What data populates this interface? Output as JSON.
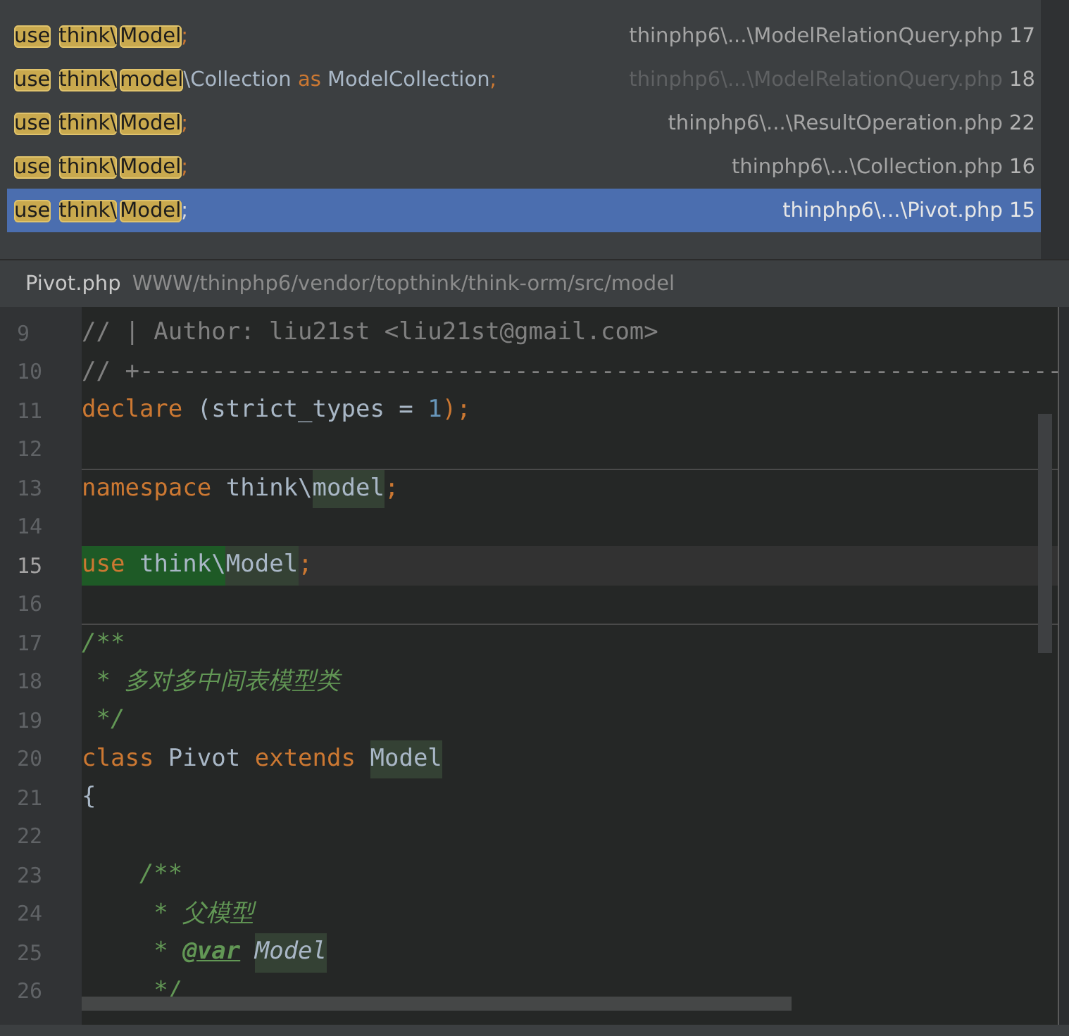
{
  "usages": [
    {
      "segments": [
        {
          "text": "use",
          "kind": "match"
        },
        {
          "text": "think\\",
          "kind": "match"
        },
        {
          "text": "Model",
          "kind": "match"
        },
        {
          "text": ";",
          "kind": "punct"
        }
      ],
      "file": "thinphp6\\...\\ModelRelationQuery.php",
      "line": "17",
      "dimmed": false,
      "selected": false
    },
    {
      "segments": [
        {
          "text": "use",
          "kind": "match"
        },
        {
          "text": "think\\",
          "kind": "match"
        },
        {
          "text": "model",
          "kind": "match"
        },
        {
          "text": "\\Collection ",
          "kind": "plain"
        },
        {
          "text": "as",
          "kind": "keyword"
        },
        {
          "text": " ModelCollection",
          "kind": "plain"
        },
        {
          "text": ";",
          "kind": "punct"
        }
      ],
      "file": "thinphp6\\...\\ModelRelationQuery.php",
      "line": "18",
      "dimmed": true,
      "selected": false
    },
    {
      "segments": [
        {
          "text": "use",
          "kind": "match"
        },
        {
          "text": "think\\",
          "kind": "match"
        },
        {
          "text": "Model",
          "kind": "match"
        },
        {
          "text": ";",
          "kind": "punct"
        }
      ],
      "file": "thinphp6\\...\\ResultOperation.php",
      "line": "22",
      "dimmed": false,
      "selected": false
    },
    {
      "segments": [
        {
          "text": "use",
          "kind": "match"
        },
        {
          "text": "think\\",
          "kind": "match"
        },
        {
          "text": "Model",
          "kind": "match"
        },
        {
          "text": ";",
          "kind": "punct"
        }
      ],
      "file": "thinphp6\\...\\Collection.php",
      "line": "16",
      "dimmed": false,
      "selected": false
    },
    {
      "segments": [
        {
          "text": "use",
          "kind": "match"
        },
        {
          "text": "think\\",
          "kind": "match"
        },
        {
          "text": "Model",
          "kind": "match"
        },
        {
          "text": ";",
          "kind": "punct"
        }
      ],
      "file": "thinphp6\\...\\Pivot.php",
      "line": "15",
      "dimmed": false,
      "selected": true
    }
  ],
  "preview": {
    "file_name": "Pivot.php",
    "path": "WWW/thinphp6/vendor/topthink/think-orm/src/model"
  },
  "code": [
    {
      "number": "9",
      "current": false,
      "separator_above": false,
      "tokens": [
        {
          "text": "// | Author: liu21st <liu21st@gmail.com>",
          "kind": "comment"
        }
      ]
    },
    {
      "number": "10",
      "current": false,
      "separator_above": false,
      "tokens": [
        {
          "text": "// +----------------------------------------------------------------",
          "kind": "comment"
        }
      ]
    },
    {
      "number": "11",
      "current": false,
      "separator_above": false,
      "tokens": [
        {
          "text": "declare",
          "kind": "keyword"
        },
        {
          "text": " (strict_types = ",
          "kind": "plain"
        },
        {
          "text": "1",
          "kind": "number"
        },
        {
          "text": ");",
          "kind": "punct"
        }
      ]
    },
    {
      "number": "12",
      "current": false,
      "separator_above": false
    },
    {
      "number": "13",
      "current": false,
      "separator_above": true,
      "tokens": [
        {
          "text": "namespace",
          "kind": "keyword"
        },
        {
          "text": " think\\",
          "kind": "plain"
        },
        {
          "text": "model",
          "kind": "plain",
          "match_highlight": true
        },
        {
          "text": ";",
          "kind": "punct"
        }
      ]
    },
    {
      "number": "14",
      "current": false,
      "separator_above": false
    },
    {
      "number": "15",
      "current": true,
      "separator_above": false,
      "tokens": [
        {
          "text": "use",
          "kind": "keyword",
          "usage_highlight": true
        },
        {
          "text": " think\\",
          "kind": "plain",
          "usage_highlight": true
        },
        {
          "text": "Model",
          "kind": "plain",
          "match_highlight": true
        },
        {
          "text": ";",
          "kind": "punct"
        }
      ]
    },
    {
      "number": "16",
      "current": false,
      "separator_above": false
    },
    {
      "number": "17",
      "current": false,
      "separator_above": true,
      "tokens": [
        {
          "text": "/**",
          "kind": "doc"
        }
      ]
    },
    {
      "number": "18",
      "current": false,
      "separator_above": false,
      "tokens": [
        {
          "text": " * 多对多中间表模型类",
          "kind": "doc"
        }
      ]
    },
    {
      "number": "19",
      "current": false,
      "separator_above": false,
      "tokens": [
        {
          "text": " */",
          "kind": "doc"
        }
      ]
    },
    {
      "number": "20",
      "current": false,
      "separator_above": false,
      "tokens": [
        {
          "text": "class",
          "kind": "keyword"
        },
        {
          "text": " Pivot ",
          "kind": "plain"
        },
        {
          "text": "extends ",
          "kind": "keyword"
        },
        {
          "text": "Model",
          "kind": "plain",
          "match_highlight": true
        }
      ]
    },
    {
      "number": "21",
      "current": false,
      "separator_above": false,
      "tokens": [
        {
          "text": "{",
          "kind": "plain"
        }
      ]
    },
    {
      "number": "22",
      "current": false,
      "separator_above": false
    },
    {
      "number": "23",
      "current": false,
      "separator_above": false,
      "tokens": [
        {
          "text": "    /**",
          "kind": "doc"
        }
      ]
    },
    {
      "number": "24",
      "current": false,
      "separator_above": false,
      "tokens": [
        {
          "text": "     * 父模型",
          "kind": "doc"
        }
      ]
    },
    {
      "number": "25",
      "current": false,
      "separator_above": false,
      "tokens": [
        {
          "text": "     * ",
          "kind": "doc"
        },
        {
          "text": "@var",
          "kind": "doctag"
        },
        {
          "text": "Model",
          "kind": "doctype",
          "match_highlight": true
        }
      ]
    },
    {
      "number": "26",
      "current": false,
      "separator_above": false,
      "tokens": [
        {
          "text": "     */",
          "kind": "doc"
        }
      ]
    }
  ]
}
